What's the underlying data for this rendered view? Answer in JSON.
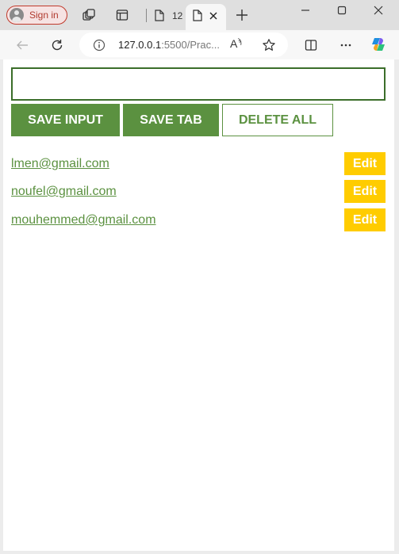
{
  "browser": {
    "signin_label": "Sign in",
    "background_tab_title": "12",
    "url_host": "127.0.0.1",
    "url_rest": ":5500/Prac...",
    "icons": [
      "avatar-icon",
      "workspaces-icon",
      "tab-actions-icon",
      "page-icon",
      "close-icon",
      "new-tab-icon",
      "minimize-icon",
      "maximize-icon",
      "close-window-icon",
      "back-icon",
      "refresh-icon",
      "info-icon",
      "read-aloud-icon",
      "favorite-icon",
      "split-screen-icon",
      "more-icon",
      "copilot-icon"
    ]
  },
  "app": {
    "input_value": "",
    "buttons": {
      "save_input": "SAVE INPUT",
      "save_tab": "SAVE TAB",
      "delete_all": "DELETE ALL"
    },
    "leads": [
      {
        "text": "lmen@gmail.com",
        "edit_label": "Edit"
      },
      {
        "text": "noufel@gmail.com",
        "edit_label": "Edit"
      },
      {
        "text": "mouhemmed@gmail.com",
        "edit_label": "Edit"
      }
    ],
    "colors": {
      "green": "#5b9140",
      "input_border": "#3b6e2a",
      "edit_yellow": "#ffcc00"
    }
  }
}
